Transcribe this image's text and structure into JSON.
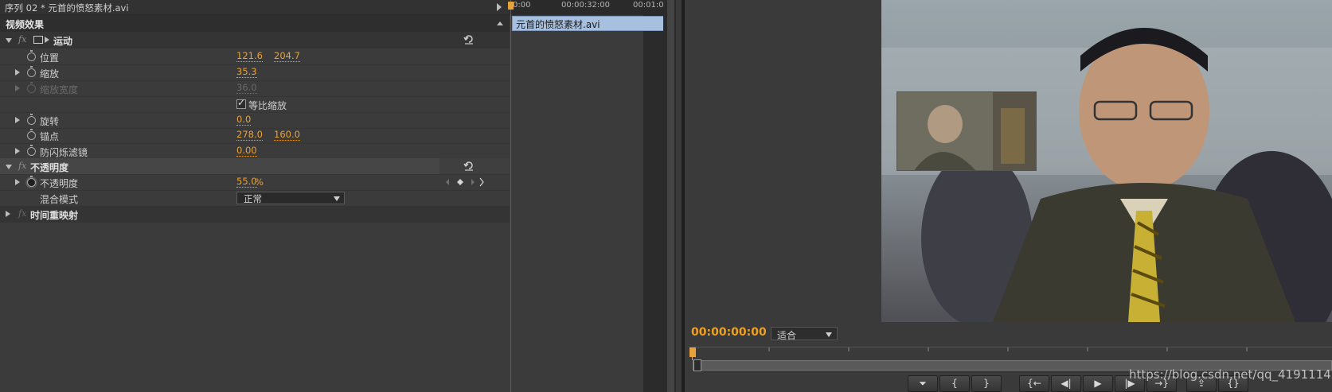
{
  "effect_controls": {
    "sequence_crumb": "序列 02 * 元首的愤怒素材.avi",
    "section_title": "视频效果",
    "motion": {
      "name": "运动",
      "position": {
        "label": "位置",
        "x": "121.6",
        "y": "204.7"
      },
      "scale": {
        "label": "缩放",
        "value": "35.3"
      },
      "scale_width": {
        "label": "缩放宽度",
        "value": "36.0"
      },
      "uniform_scale": {
        "label": "等比缩放",
        "checked": true
      },
      "rotation": {
        "label": "旋转",
        "value": "0.0"
      },
      "anchor": {
        "label": "锚点",
        "x": "278.0",
        "y": "160.0"
      },
      "anti_flicker": {
        "label": "防闪烁滤镜",
        "value": "0.00"
      }
    },
    "opacity": {
      "name": "不透明度",
      "opacity": {
        "label": "不透明度",
        "value": "55.0",
        "unit": "%"
      },
      "blend": {
        "label": "混合模式",
        "value": "正常"
      }
    },
    "time_remap": {
      "name": "时间重映射"
    }
  },
  "mini_timeline": {
    "ruler": [
      "0:00",
      "00:00:32:00",
      "00:01:0"
    ],
    "clip_name": "元首的愤怒素材.avi"
  },
  "program_monitor": {
    "timecode": "00:00:00:00",
    "fit_label": "适合",
    "controls": [
      "⏷",
      "{",
      "}",
      "{←",
      "◀|",
      "▶",
      "|▶",
      "→}",
      "⇪",
      "{}"
    ]
  },
  "watermark": "https://blog.csdn.net/qq_41911142",
  "colors": {
    "value_orange": "#e8a23a",
    "clip_blue": "#a7c0df",
    "playhead_red": "#d22b2b"
  }
}
